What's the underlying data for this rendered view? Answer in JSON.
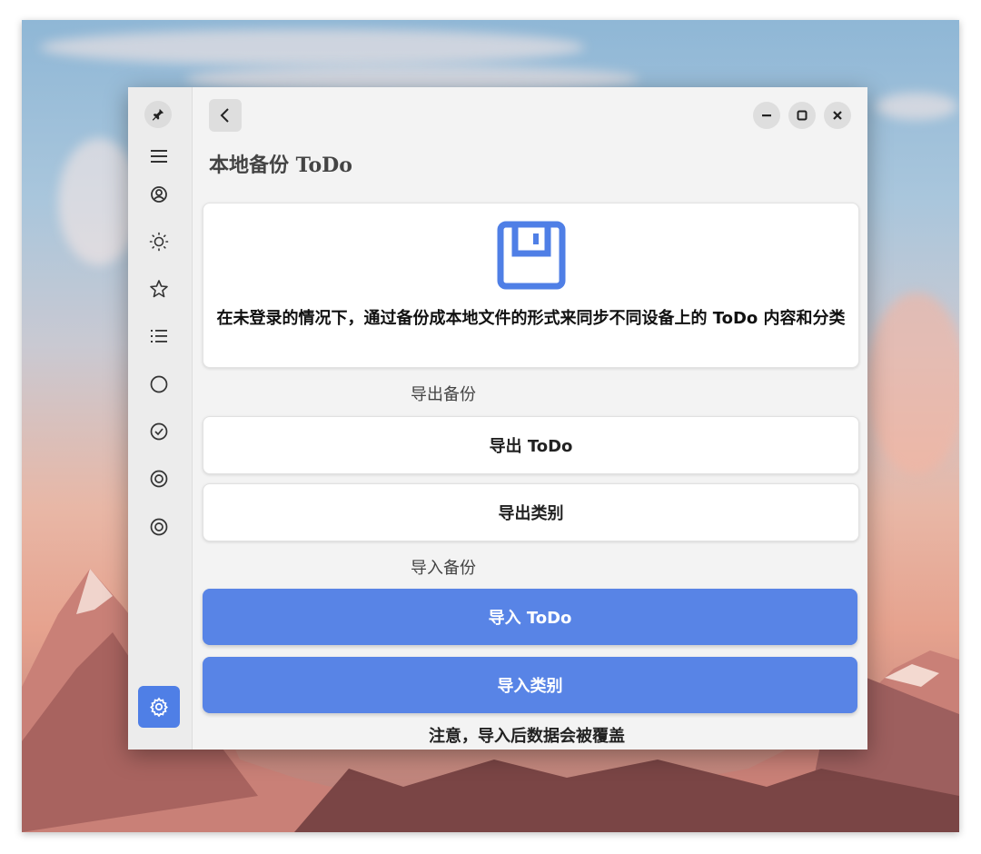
{
  "window": {
    "page_title": "本地备份 ToDo",
    "controls": {
      "minimize_icon": "minus-icon",
      "maximize_icon": "square-icon",
      "close_icon": "x-icon"
    },
    "back_icon": "chevron-left-icon"
  },
  "sidebar": {
    "items": [
      {
        "icon": "pin-icon"
      },
      {
        "icon": "menu-icon"
      },
      {
        "icon": "account-icon"
      },
      {
        "icon": "sun-icon"
      },
      {
        "icon": "star-icon"
      },
      {
        "icon": "list-icon"
      },
      {
        "icon": "circle-icon"
      },
      {
        "icon": "check-circle-icon"
      },
      {
        "icon": "target-icon"
      },
      {
        "icon": "target-icon"
      }
    ],
    "settings_icon": "gear-icon"
  },
  "info_card": {
    "icon": "floppy-disk-icon",
    "text": "在未登录的情况下，通过备份成本地文件的形式来同步不同设备上的 ToDo 内容和分类"
  },
  "export_section": {
    "label": "导出备份",
    "buttons": [
      "导出 ToDo",
      "导出类别"
    ]
  },
  "import_section": {
    "label": "导入备份",
    "buttons": [
      "导入 ToDo",
      "导入类别"
    ]
  },
  "warning": "注意，导入后数据会被覆盖",
  "colors": {
    "accent": "#5884e6",
    "window_bg": "#f3f3f3",
    "sidebar_bg": "#ececec"
  }
}
